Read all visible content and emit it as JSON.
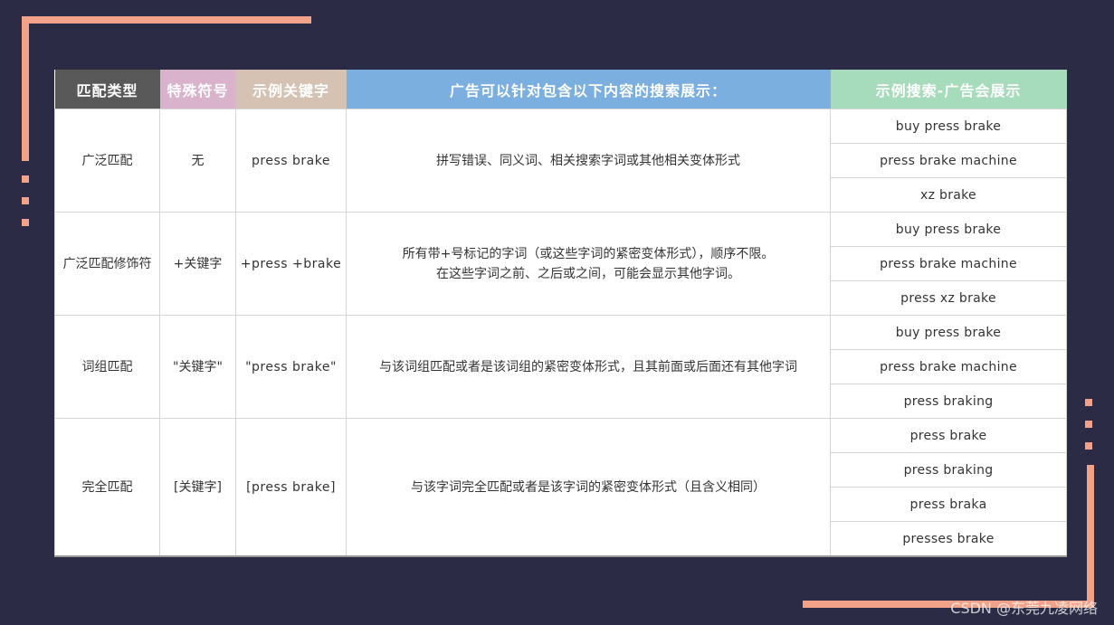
{
  "headers": [
    "匹配类型",
    "特殊符号",
    "示例关键字",
    "广告可以针对包含以下内容的搜索展示：",
    "示例搜索-广告会展示"
  ],
  "header_colors": [
    "#595959",
    "#d9b3cb",
    "#d6c2b3",
    "#7aafe0",
    "#a6dbbb"
  ],
  "rows": [
    {
      "type": "广泛匹配",
      "symbol": "无",
      "keyword": "press brake",
      "desc": [
        "拼写错误、同义词、相关搜索字词或其他相关变体形式"
      ],
      "examples": [
        "buy press brake",
        "press brake machine",
        "xz brake"
      ]
    },
    {
      "type": "广泛匹配修饰符",
      "symbol": "+关键字",
      "keyword": "+press +brake",
      "desc": [
        "所有带+号标记的字词（或这些字词的紧密变体形式），顺序不限。",
        "在这些字词之前、之后或之间，可能会显示其他字词。"
      ],
      "examples": [
        "buy press brake",
        "press brake machine",
        "press xz brake"
      ]
    },
    {
      "type": "词组匹配",
      "symbol": "\"关键字\"",
      "keyword": "\"press brake\"",
      "desc": [
        "与该词组匹配或者是该词组的紧密变体形式，且其前面或后面还有其他字词"
      ],
      "examples": [
        "buy press brake",
        "press brake machine",
        "press braking"
      ]
    },
    {
      "type": "完全匹配",
      "symbol": "[关键字]",
      "keyword": "[press brake]",
      "desc": [
        "与该字词完全匹配或者是该字词的紧密变体形式（且含义相同）"
      ],
      "examples": [
        "press brake",
        "press braking",
        "press braka",
        "presses brake"
      ]
    }
  ],
  "watermark": "CSDN @东莞九凌网络"
}
